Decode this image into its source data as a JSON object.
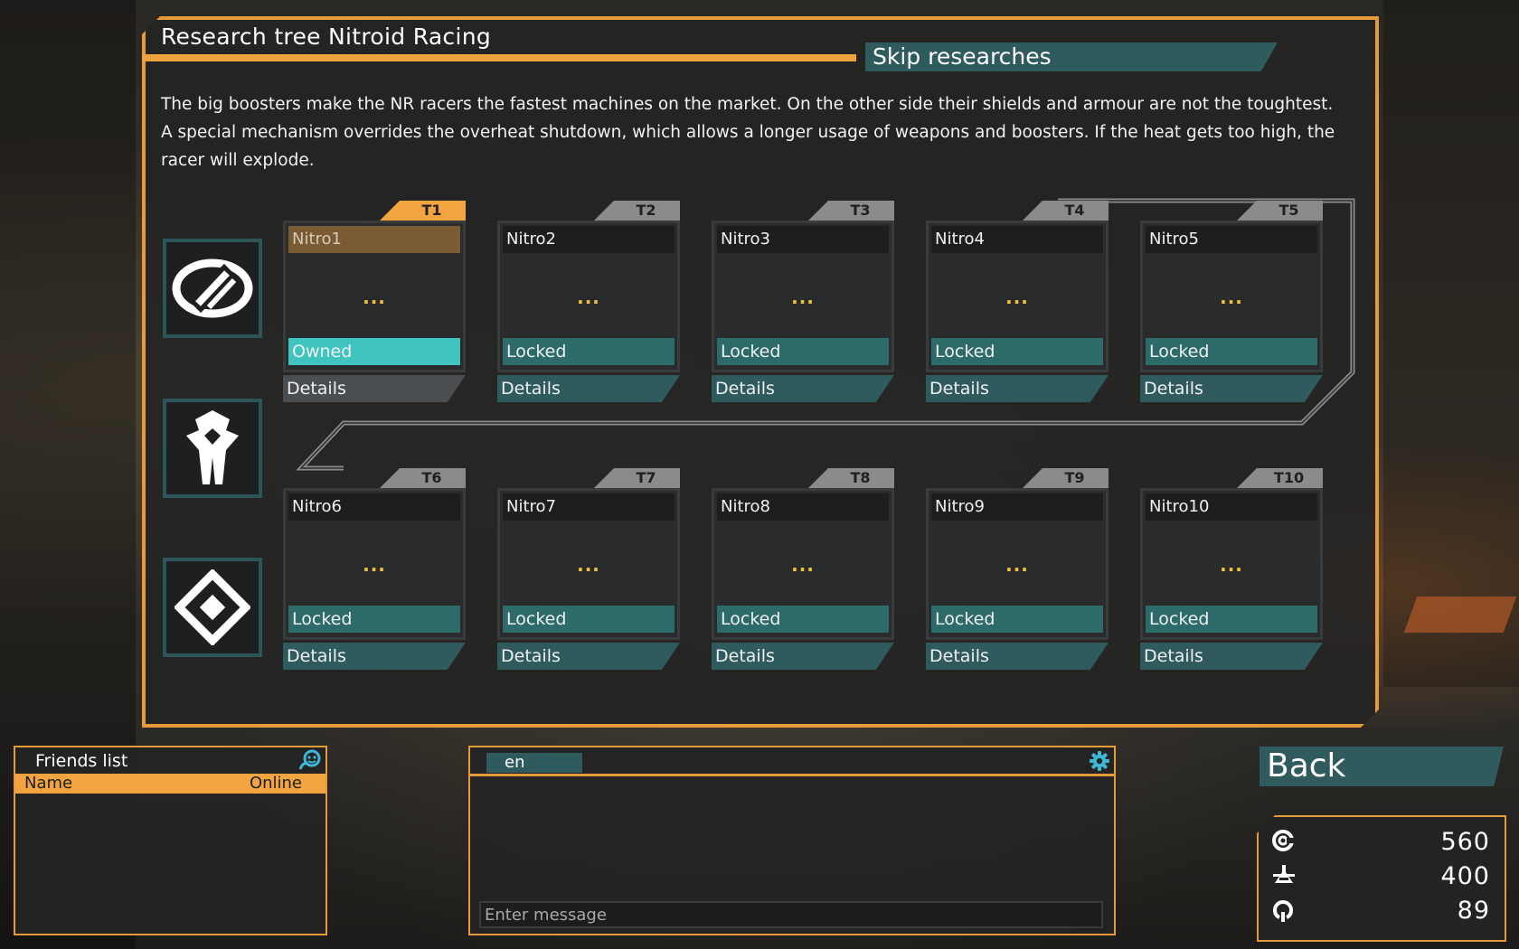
{
  "panel": {
    "title": "Research tree Nitroid Racing",
    "skip_label": "Skip researches",
    "description": "The big boosters make the NR racers the fastest machines on the market. On the other side their shields and armour are not the toughtest. A special mechanism overrides the overheat shutdown, which allows a longer usage of weapons and boosters. If the heat gets too high, the racer will explode."
  },
  "categories": [
    {
      "icon": "shield-slash-icon"
    },
    {
      "icon": "thruster-icon"
    },
    {
      "icon": "diamond-icon"
    }
  ],
  "cards": [
    {
      "tier": "T1",
      "name": "Nitro1",
      "dots": "...",
      "status": "Owned",
      "details": "Details",
      "active": true
    },
    {
      "tier": "T2",
      "name": "Nitro2",
      "dots": "...",
      "status": "Locked",
      "details": "Details"
    },
    {
      "tier": "T3",
      "name": "Nitro3",
      "dots": "...",
      "status": "Locked",
      "details": "Details"
    },
    {
      "tier": "T4",
      "name": "Nitro4",
      "dots": "...",
      "status": "Locked",
      "details": "Details"
    },
    {
      "tier": "T5",
      "name": "Nitro5",
      "dots": "...",
      "status": "Locked",
      "details": "Details"
    },
    {
      "tier": "T6",
      "name": "Nitro6",
      "dots": "...",
      "status": "Locked",
      "details": "Details"
    },
    {
      "tier": "T7",
      "name": "Nitro7",
      "dots": "...",
      "status": "Locked",
      "details": "Details"
    },
    {
      "tier": "T8",
      "name": "Nitro8",
      "dots": "...",
      "status": "Locked",
      "details": "Details"
    },
    {
      "tier": "T9",
      "name": "Nitro9",
      "dots": "...",
      "status": "Locked",
      "details": "Details"
    },
    {
      "tier": "T10",
      "name": "Nitro10",
      "dots": "...",
      "status": "Locked",
      "details": "Details"
    }
  ],
  "friends": {
    "title": "Friends list",
    "col_name": "Name",
    "col_online": "Online"
  },
  "chat": {
    "tab": "en",
    "placeholder": "Enter message"
  },
  "back_label": "Back",
  "wallet": {
    "credits": "560",
    "research": "400",
    "tokens": "89"
  },
  "colors": {
    "accent_orange": "#f2a440",
    "teal": "#2f5a5e",
    "owned_cyan": "#40c4c0"
  }
}
